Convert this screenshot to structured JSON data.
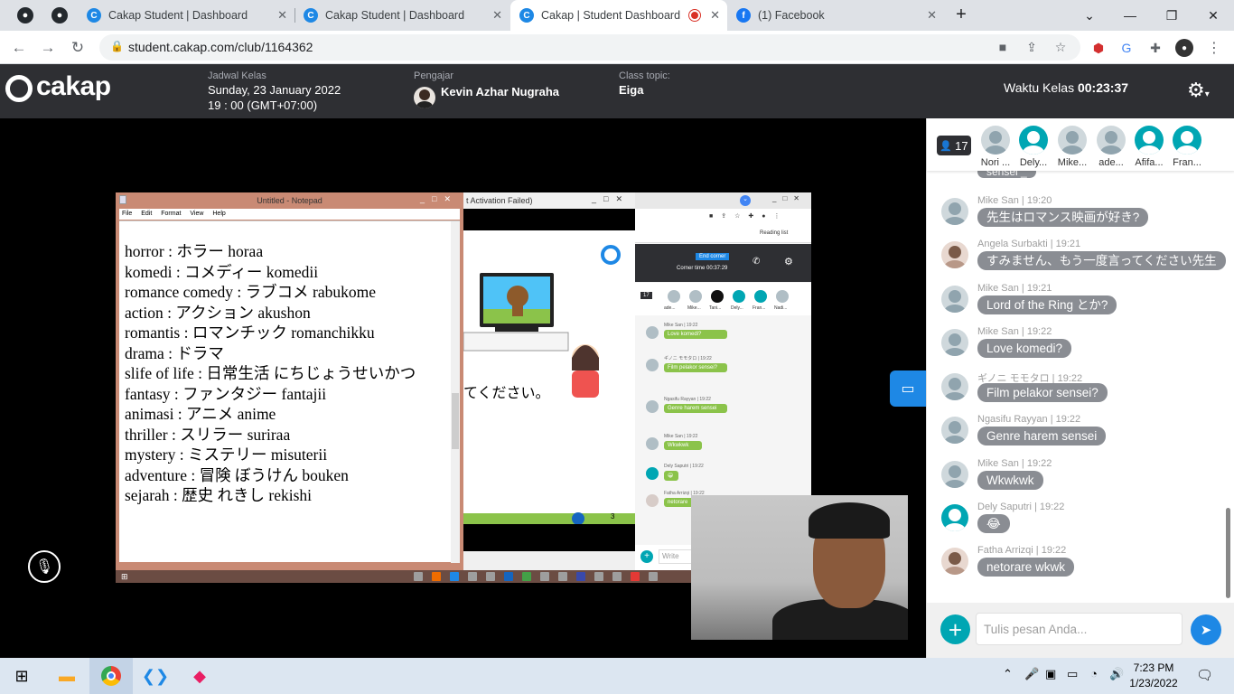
{
  "browser": {
    "tabs": [
      {
        "title": "Cakap Student | Dashboard",
        "active": false
      },
      {
        "title": "Cakap Student | Dashboard",
        "active": false
      },
      {
        "title": "Cakap | Student Dashboard",
        "active": true
      },
      {
        "title": "(1) Facebook",
        "active": false
      }
    ],
    "url": "student.cakap.com/club/1164362"
  },
  "header": {
    "logo": "cakap",
    "schedule_label": "Jadwal Kelas",
    "schedule_date": "Sunday, 23 January 2022",
    "schedule_time": "19 : 00 (GMT+07:00)",
    "teacher_label": "Pengajar",
    "teacher_name": "Kevin Azhar Nugraha",
    "topic_label": "Class topic:",
    "topic": "Eiga",
    "timer_label": "Waktu Kelas",
    "timer_value": "00:23:37"
  },
  "shared_screen": {
    "notepad_title": "Untitled - Notepad",
    "notepad_menu": [
      "File",
      "Edit",
      "Format",
      "View",
      "Help"
    ],
    "notepad_lines": [
      "horror : ホラー   horaa",
      "komedi : コメディー   komedii",
      "romance comedy : ラブコメ rabukome",
      "action : アクション   akushon",
      "romantis : ロマンチック   romanchikku",
      "drama : ドラマ",
      "slife of life : 日常生活   にちじょうせいかつ",
      "fantasy : ファンタジー   fantajii",
      "animasi : アニメ   anime",
      "thriller : スリラー   suriraa",
      "mystery : ミステリー   misuterii",
      "adventure : 冒険   ぼうけん bouken",
      "sejarah : 歴史   れきし rekishi"
    ],
    "slide_title": "t Activation Failed)",
    "slide_text": "てください。",
    "slide_page": "3",
    "mini_reading_list": "Reading list",
    "mini_end_corner": "End corner",
    "mini_corner_time": "Corner time 00:37:29",
    "mini_count": "17",
    "mini_names": [
      "ade...",
      "Mike...",
      "Tani...",
      "",
      "Dely...",
      "Fran...",
      "Nadi..."
    ],
    "mini_messages": [
      {
        "meta": "Mike San | 19:22",
        "text": "Love komedi?"
      },
      {
        "meta": "ギノニ モモタロ | 19:22",
        "text": "Film pelakor sensei?"
      },
      {
        "meta": "Ngasifu Rayyan | 19:22",
        "text": "Genre harem sensei"
      },
      {
        "meta": "Mike San | 19:22",
        "text": "Wkwkwk"
      },
      {
        "meta": "Dely Saputri | 19:22",
        "text": "😀"
      },
      {
        "meta": "Fatha Arrizqi | 19:22",
        "text": "netorare"
      }
    ],
    "mini_write": "Write"
  },
  "participants": {
    "count": "17",
    "list": [
      {
        "name": "Nori ...",
        "teal": false
      },
      {
        "name": "Dely...",
        "teal": true
      },
      {
        "name": "Mike...",
        "teal": false
      },
      {
        "name": "ade...",
        "teal": false
      },
      {
        "name": "Afifa...",
        "teal": true
      },
      {
        "name": "Fran...",
        "teal": true
      }
    ]
  },
  "chat": {
    "partial_top": "sensei _",
    "messages": [
      {
        "sender": "Mike San | 19:20",
        "text": "先生はロマンス映画が好き?",
        "avatar": "default"
      },
      {
        "sender": "Angela Surbakti | 19:21",
        "text": "すみません、もう一度言ってください先生",
        "avatar": "photo"
      },
      {
        "sender": "Mike San | 19:21",
        "text": "Lord of the Ring とか?",
        "avatar": "default"
      },
      {
        "sender": "Mike San | 19:22",
        "text": "Love komedi?",
        "avatar": "default"
      },
      {
        "sender": "ギノニ モモタロ | 19:22",
        "text": "Film pelakor sensei?",
        "avatar": "default"
      },
      {
        "sender": "Ngasifu Rayyan | 19:22",
        "text": "Genre harem sensei",
        "avatar": "default"
      },
      {
        "sender": "Mike San | 19:22",
        "text": "Wkwkwk",
        "avatar": "default"
      },
      {
        "sender": "Dely Saputri | 19:22",
        "text": "😂",
        "avatar": "teal"
      },
      {
        "sender": "Fatha Arrizqi | 19:22",
        "text": "netorare wkwk",
        "avatar": "photo"
      }
    ],
    "input_placeholder": "Tulis pesan Anda..."
  },
  "taskbar": {
    "time": "7:23 PM",
    "date": "1/23/2022"
  },
  "colors": {
    "header_bg": "#2e2f33",
    "accent_teal": "#00a6b3",
    "send_blue": "#1e88e5",
    "bubble_gray": "#8a8d93"
  }
}
